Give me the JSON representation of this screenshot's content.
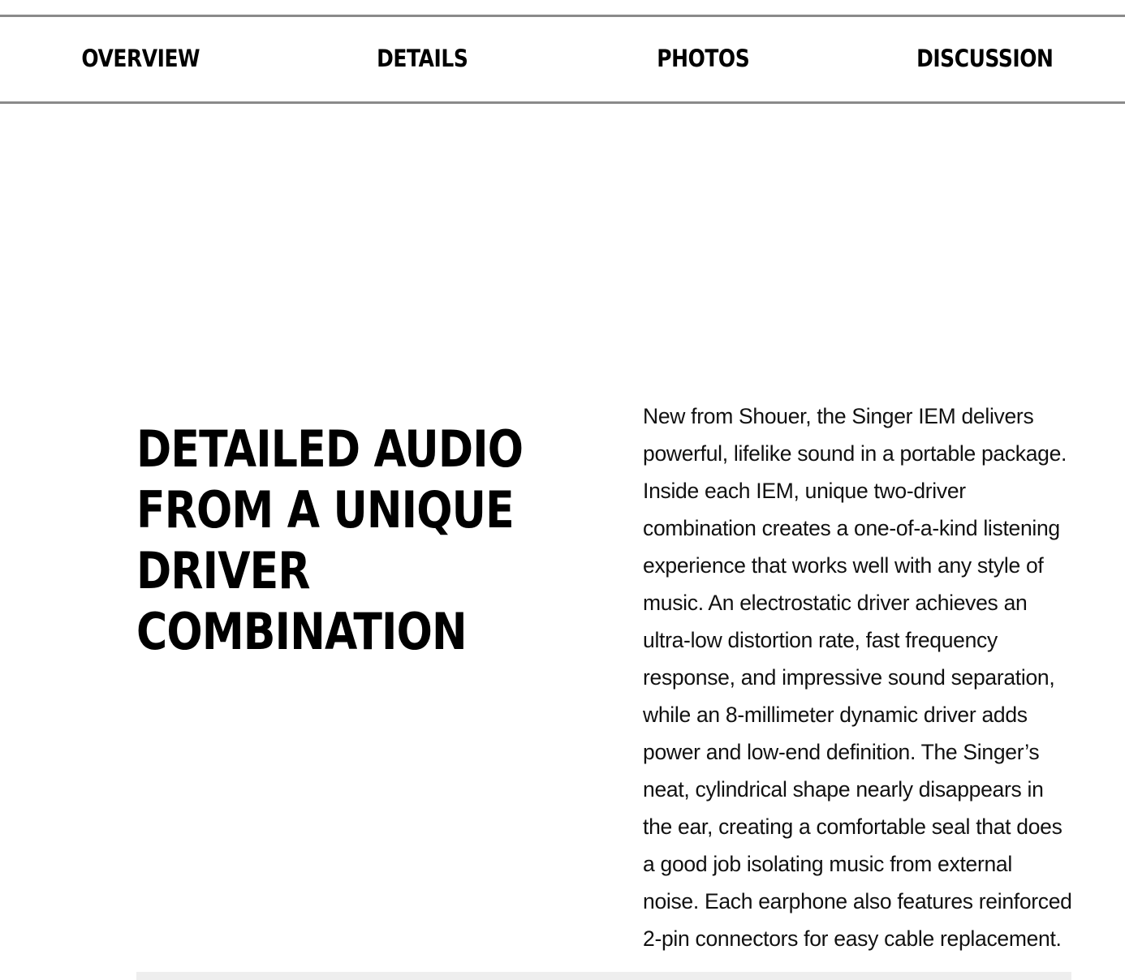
{
  "nav": {
    "tabs": [
      {
        "label": "OVERVIEW"
      },
      {
        "label": "DETAILS"
      },
      {
        "label": "PHOTOS"
      },
      {
        "label": "DISCUSSION"
      }
    ]
  },
  "hero": {
    "headline": "DETAILED AUDIO FROM A UNIQUE DRIVER COMBINATION",
    "body": "New from Shouer, the Singer IEM delivers powerful, lifelike sound in a portable package. Inside each IEM, unique two-driver combination creates a one-of-a-kind listening experience that works well with any style of music. An electrostatic driver achieves an ultra-low distortion rate, fast frequency response, and impressive sound separation, while an 8-millimeter dynamic driver adds power and low-end definition. The Singer’s neat, cylindrical shape nearly disappears in the ear, creating a comfortable seal that does a good job isolating music from external noise. Each earphone also features reinforced 2-pin connectors for easy cable replacement."
  },
  "colors": {
    "divider": "#8a8a8a",
    "text": "#000000",
    "background": "#ffffff",
    "strip": "#eeeeee"
  }
}
